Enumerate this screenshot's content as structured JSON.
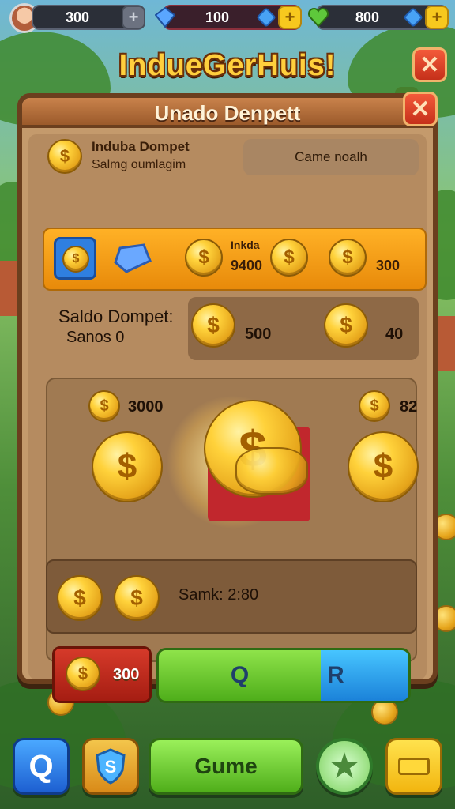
{
  "topbar": {
    "coins": "300",
    "gems": "100",
    "hearts": "800",
    "add_symbol": "+"
  },
  "title": "IndueGerHuis!",
  "close_symbol": "✕",
  "panel": {
    "header": "Unado Denpett",
    "wallet": {
      "label": "Induba Dompet",
      "sublabel": "Salmg oumlagim",
      "button": "Came noalh"
    },
    "orange_row": {
      "tag": "Inkda",
      "coin_value": "9400",
      "right_value": "300"
    },
    "saldo": {
      "label": "Saldo Dompet:",
      "sub": "Sanos 0",
      "value_mid": "500",
      "value_right": "40"
    },
    "coin_area": {
      "left_value": "3000",
      "right_value": "82"
    },
    "status": "Samk: 2:80",
    "buttons": {
      "red_value": "300",
      "green_label": "Q",
      "blue_label": "R"
    }
  },
  "nav": {
    "search": "Q",
    "shield": "S",
    "play": "Gume"
  },
  "colors": {
    "gold": "#ffcf3d",
    "brown": "#6b3f1e",
    "orange": "#ffb126",
    "green": "#4fae1a",
    "blue": "#1b82d9",
    "red": "#c5301a"
  }
}
